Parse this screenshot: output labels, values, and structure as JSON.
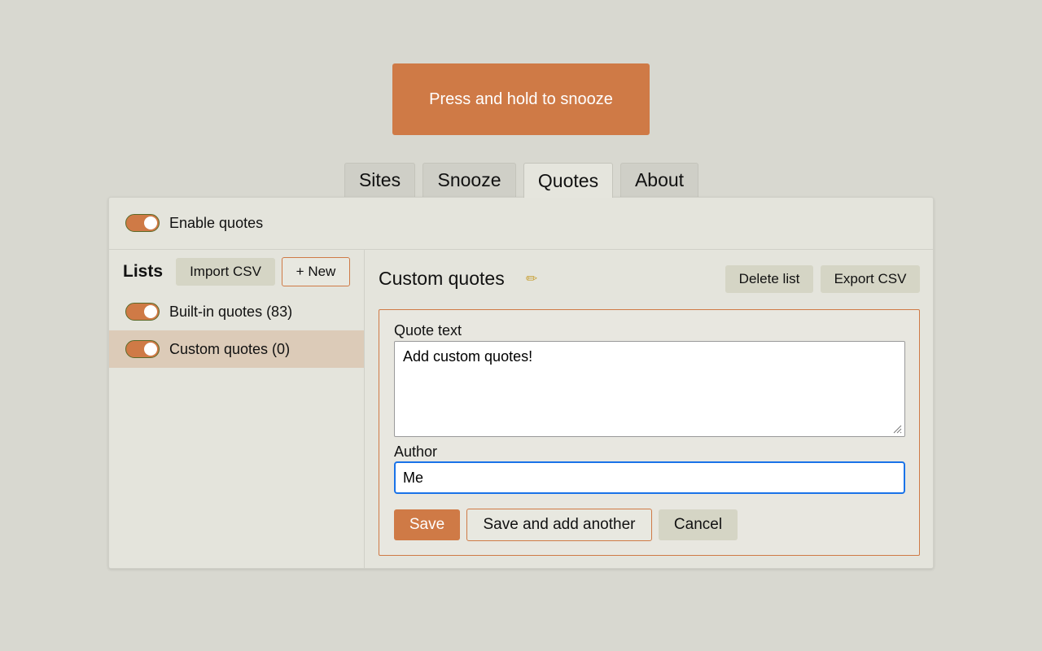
{
  "snooze_button": {
    "label": "Press and hold to snooze"
  },
  "tabs": [
    {
      "label": "Sites",
      "active": false
    },
    {
      "label": "Snooze",
      "active": false
    },
    {
      "label": "Quotes",
      "active": true
    },
    {
      "label": "About",
      "active": false
    }
  ],
  "enable_quotes": {
    "label": "Enable quotes",
    "enabled": true
  },
  "lists_panel": {
    "title": "Lists",
    "import_label": "Import CSV",
    "new_label": "+ New",
    "items": [
      {
        "label": "Built-in quotes (83)",
        "enabled": true,
        "selected": false
      },
      {
        "label": "Custom quotes (0)",
        "enabled": true,
        "selected": true
      }
    ]
  },
  "editor": {
    "title": "Custom quotes",
    "edit_icon": "pencil-icon",
    "delete_label": "Delete list",
    "export_label": "Export CSV",
    "form": {
      "quote_label": "Quote text",
      "quote_value": "Add custom quotes!",
      "author_label": "Author",
      "author_value": "Me",
      "save_label": "Save",
      "save_another_label": "Save and add another",
      "cancel_label": "Cancel"
    }
  },
  "colors": {
    "accent": "#cf7a46",
    "background": "#d8d8d0",
    "panel": "#e4e4dc",
    "selected_row": "#dccbb8",
    "focus": "#1a73e8"
  }
}
